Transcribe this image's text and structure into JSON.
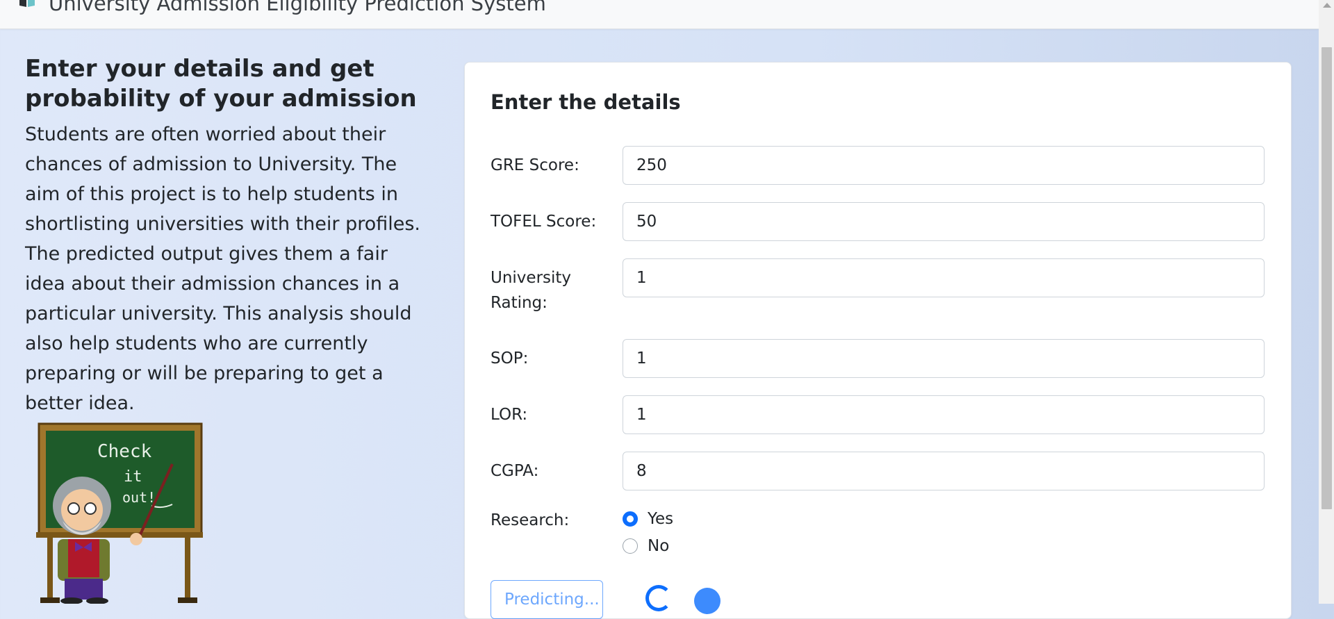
{
  "header": {
    "title": "University Admission Eligibility Prediction System",
    "logo_icon": "book-logo-icon"
  },
  "intro": {
    "heading": "Enter your details and get probability of your admission",
    "description": "Students are often worried about their chances of admission to University. The aim of this project is to help students in shortlisting universities with their profiles. The predicted output gives them a fair idea about their admission chances in a particular university. This analysis should also help students who are currently preparing or will be preparing to get a better idea.",
    "illustration_text": "Check it out"
  },
  "form": {
    "title": "Enter the details",
    "fields": {
      "gre": {
        "label": "GRE Score:",
        "value": "250"
      },
      "tofel": {
        "label": "TOFEL Score:",
        "value": "50"
      },
      "rating": {
        "label": "University Rating:",
        "value": "1"
      },
      "sop": {
        "label": "SOP:",
        "value": "1"
      },
      "lor": {
        "label": "LOR:",
        "value": "1"
      },
      "cgpa": {
        "label": "CGPA:",
        "value": "8"
      }
    },
    "research": {
      "label": "Research:",
      "options": [
        "Yes",
        "No"
      ],
      "selected": "Yes"
    },
    "submit_label": "Predicting..."
  },
  "colors": {
    "accent": "#0d6efd"
  }
}
